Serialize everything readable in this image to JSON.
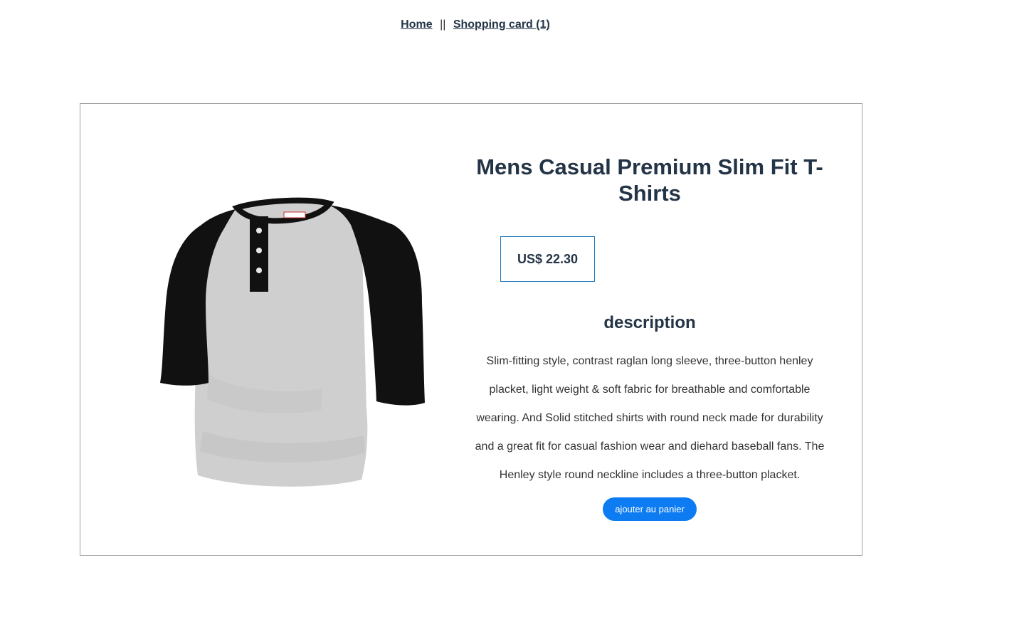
{
  "nav": {
    "home_label": "Home",
    "separator": "||",
    "cart_label": "Shopping card (1)"
  },
  "product": {
    "title": "Mens Casual Premium Slim Fit T-Shirts",
    "price": "US$ 22.30",
    "description_heading": "description",
    "description": "Slim-fitting style, contrast raglan long sleeve, three-button henley placket, light weight & soft fabric for breathable and comfortable wearing. And Solid stitched shirts with round neck made for durability and a great fit for casual fashion wear and diehard baseball fans. The Henley style round neckline includes a three-button placket.",
    "add_to_cart_label": "ajouter au panier",
    "image_icon": "raglan-henley-tshirt-image"
  },
  "colors": {
    "accent": "#0d7cf2",
    "price_border": "#1b75bb",
    "text": "#243447",
    "card_border": "#a0a0a0"
  }
}
